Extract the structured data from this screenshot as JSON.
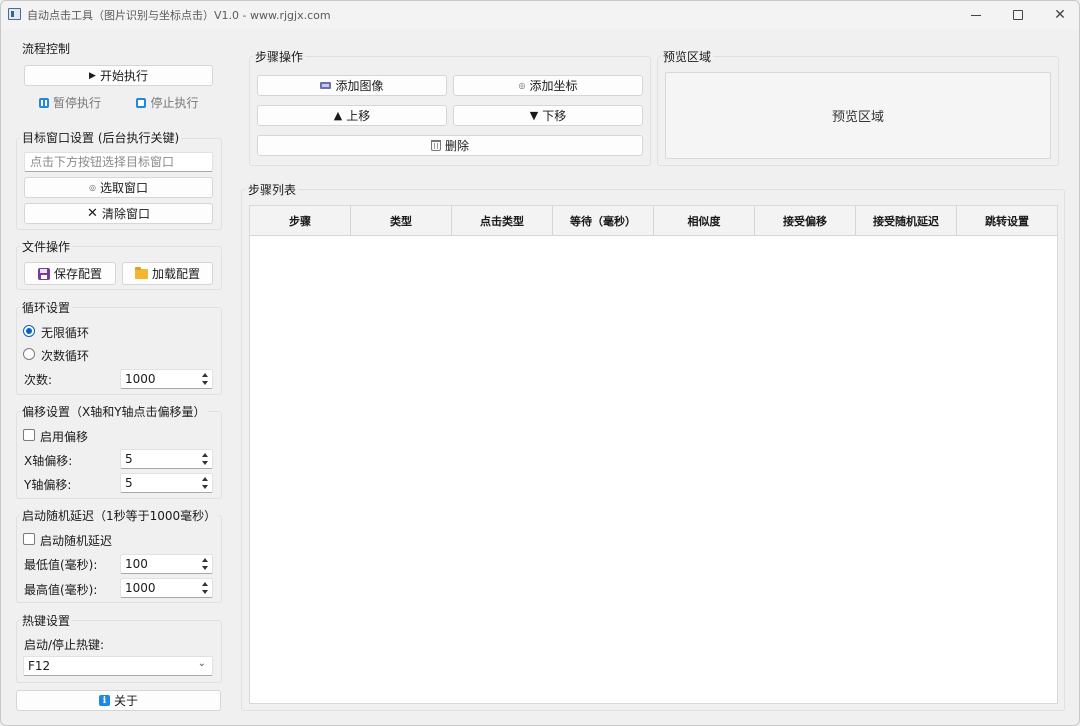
{
  "window": {
    "title": "自动点击工具（图片识别与坐标点击）V1.0 - www.rjgjx.com",
    "min_icon": "minimize-icon",
    "max_icon": "maximize-icon",
    "close_icon": "close-icon"
  },
  "flow": {
    "title": "流程控制",
    "start": "开始执行",
    "pause": "暂停执行",
    "stop": "停止执行"
  },
  "target": {
    "title": "目标窗口设置 (后台执行关键)",
    "placeholder": "点击下方按钮选择目标窗口",
    "select": "选取窗口",
    "clear": "清除窗口"
  },
  "file": {
    "title": "文件操作",
    "save": "保存配置",
    "load": "加载配置"
  },
  "loop": {
    "title": "循环设置",
    "infinite": "无限循环",
    "count_mode": "次数循环",
    "count_label": "次数:",
    "count_value": "1000",
    "selected": "infinite"
  },
  "offset": {
    "title": "偏移设置（X轴和Y轴点击偏移量）",
    "enable": "启用偏移",
    "x_label": "X轴偏移:",
    "x_value": "5",
    "y_label": "Y轴偏移:",
    "y_value": "5"
  },
  "delay": {
    "title": "启动随机延迟（1秒等于1000毫秒）",
    "enable": "启动随机延迟",
    "min_label": "最低值(毫秒):",
    "min_value": "100",
    "max_label": "最高值(毫秒):",
    "max_value": "1000"
  },
  "hotkey": {
    "title": "热键设置",
    "label": "启动/停止热键:",
    "value": "F12"
  },
  "about": "关于",
  "steps": {
    "title": "步骤操作",
    "add_image": "添加图像",
    "add_coord": "添加坐标",
    "move_up": "上移",
    "move_down": "下移",
    "delete": "删除"
  },
  "preview": {
    "title": "预览区域",
    "text": "预览区域"
  },
  "step_list": {
    "title": "步骤列表",
    "columns": [
      "步骤",
      "类型",
      "点击类型",
      "等待（毫秒）",
      "相似度",
      "接受偏移",
      "接受随机延迟",
      "跳转设置"
    ]
  },
  "colors": {
    "accent": "#1e88e5",
    "radio_checked": "#0a5fc8"
  }
}
